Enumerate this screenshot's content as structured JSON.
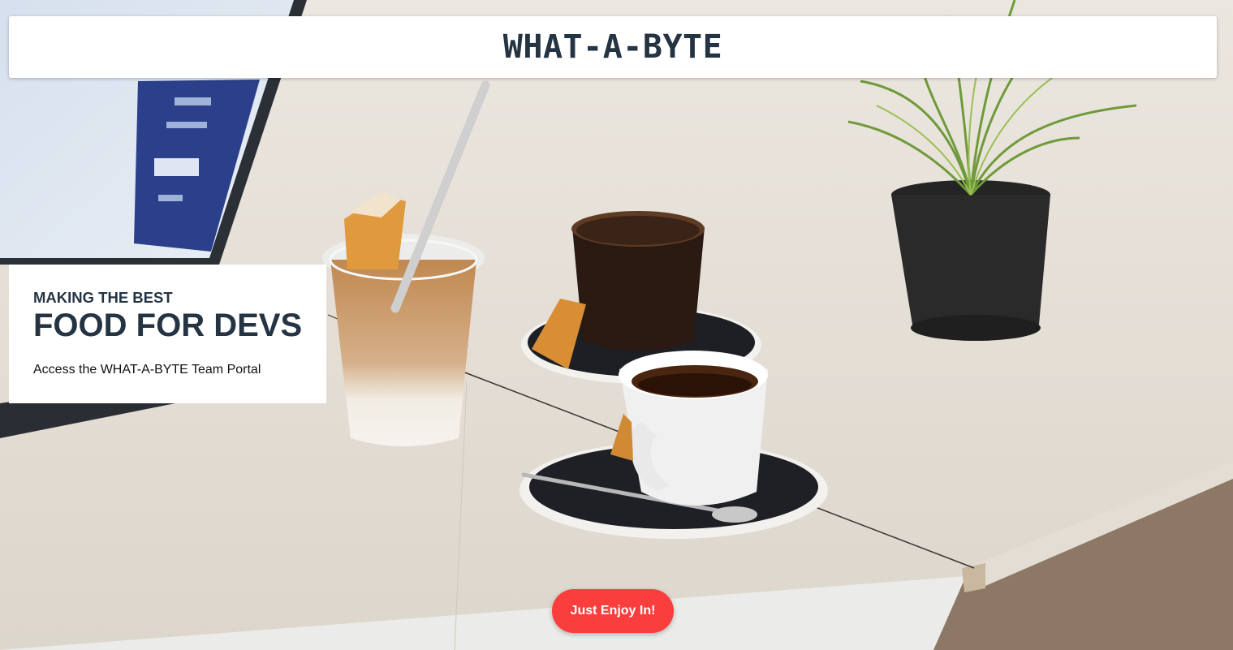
{
  "header": {
    "brand": "WHAT-A-BYTE"
  },
  "hero": {
    "subtitle": "MAKING THE BEST",
    "title": "FOOD FOR DEVS",
    "text": "Access the WHAT-A-BYTE Team Portal"
  },
  "cta": {
    "label": "Just Enjoy In!"
  },
  "colors": {
    "brand_text": "#253443",
    "cta_background": "#fa3e3e",
    "card_background": "#ffffff"
  }
}
